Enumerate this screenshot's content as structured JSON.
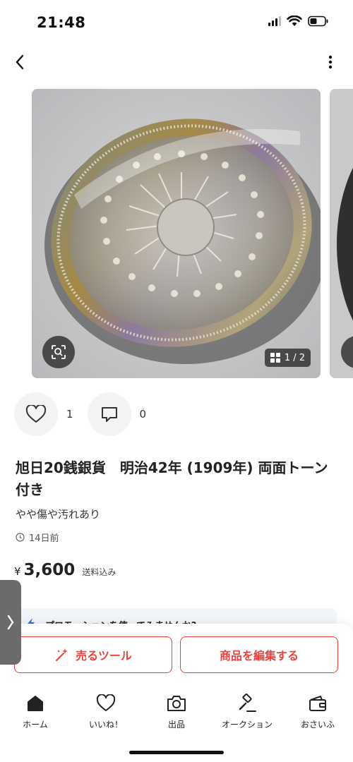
{
  "status_bar": {
    "time": "21:48"
  },
  "nav": {
    "back_icon": "chevron-left-icon",
    "more_icon": "more-vertical-icon"
  },
  "gallery": {
    "photo_description_icon": "coin-photo",
    "counter": "1 / 2",
    "zoom_icon": "image-search-icon"
  },
  "reactions": {
    "likes": "1",
    "comments": "0"
  },
  "item": {
    "title": "旭日20銭銀貨　明治42年 (1909年) 両面トーン付き",
    "condition": "やや傷や汚れあり",
    "listed": "14日前",
    "price_symbol": "¥",
    "price": "3,600",
    "shipping_note": "送料込み"
  },
  "promo": {
    "text": "プロモーションを使ってみませんか?"
  },
  "actions": {
    "sell_tools": "売るツール",
    "edit_item": "商品を編集する"
  },
  "bottom_nav": [
    {
      "label": "ホーム",
      "icon": "home-icon"
    },
    {
      "label": "いいね！",
      "icon": "heart-icon"
    },
    {
      "label": "出品",
      "icon": "camera-icon"
    },
    {
      "label": "オークション",
      "icon": "gavel-icon"
    },
    {
      "label": "おさいふ",
      "icon": "wallet-icon"
    }
  ],
  "colors": {
    "accent": "#e8433e",
    "text": "#222222",
    "overlay": "#282828"
  }
}
